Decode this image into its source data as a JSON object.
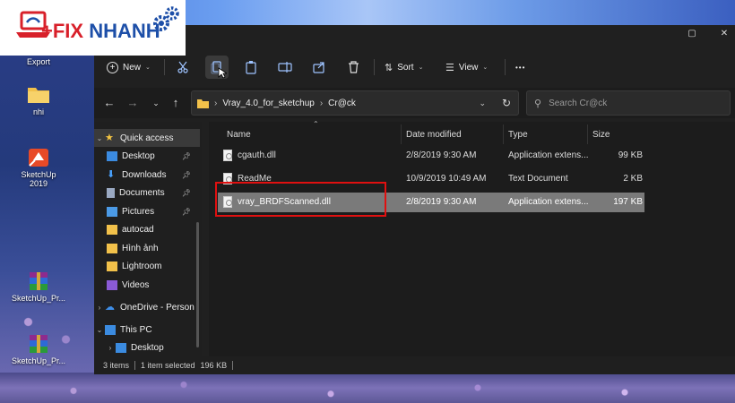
{
  "logo": {
    "brand_plus": "+FIX ",
    "brand_name": "NHANH"
  },
  "desktop": {
    "icons": [
      {
        "label": "Export",
        "icon": "folder-icon"
      },
      {
        "label": "nhi",
        "icon": "folder-icon"
      },
      {
        "label": "SketchUp\n2019",
        "icon": "sketchup-icon"
      },
      {
        "label": "SketchUp_Pr...",
        "icon": "winrar-icon"
      },
      {
        "label": "SketchUp_Pr...",
        "icon": "winrar-icon"
      }
    ]
  },
  "toolbar": {
    "new_label": "New",
    "sort_label": "Sort",
    "view_label": "View",
    "more_label": "•••"
  },
  "address": {
    "crumbs": [
      "Vray_4.0_for_sketchup",
      "Cr@ck"
    ],
    "search_placeholder": "Search Cr@ck"
  },
  "sidebar": {
    "items": [
      {
        "label": "Quick access",
        "pinned": false
      },
      {
        "label": "Desktop",
        "pinned": true
      },
      {
        "label": "Downloads",
        "pinned": true
      },
      {
        "label": "Documents",
        "pinned": true
      },
      {
        "label": "Pictures",
        "pinned": true
      },
      {
        "label": "autocad",
        "pinned": false
      },
      {
        "label": "Hình ảnh",
        "pinned": false
      },
      {
        "label": "Lightroom",
        "pinned": false
      },
      {
        "label": "Videos",
        "pinned": false
      },
      {
        "label": "OneDrive - Person",
        "pinned": false
      },
      {
        "label": "This PC",
        "pinned": false
      },
      {
        "label": "Desktop",
        "pinned": false
      }
    ]
  },
  "filelist": {
    "columns": [
      "Name",
      "Date modified",
      "Type",
      "Size"
    ],
    "rows": [
      {
        "name": "cgauth.dll",
        "date": "2/8/2019 9:30 AM",
        "type": "Application extens...",
        "size": "99 KB"
      },
      {
        "name": "ReadMe",
        "date": "10/9/2019 10:49 AM",
        "type": "Text Document",
        "size": "2 KB"
      },
      {
        "name": "vray_BRDFScanned.dll",
        "date": "2/8/2019 9:30 AM",
        "type": "Application extens...",
        "size": "197 KB"
      }
    ]
  },
  "status": {
    "items_count": "3 items",
    "selected": "1 item selected",
    "size": "196 KB"
  },
  "colors": {
    "window_bg": "#202020",
    "selected_row": "#7a7a7a",
    "highlight_box": "#e01010",
    "logo_red": "#d8202a",
    "logo_blue": "#1d4fa8"
  }
}
